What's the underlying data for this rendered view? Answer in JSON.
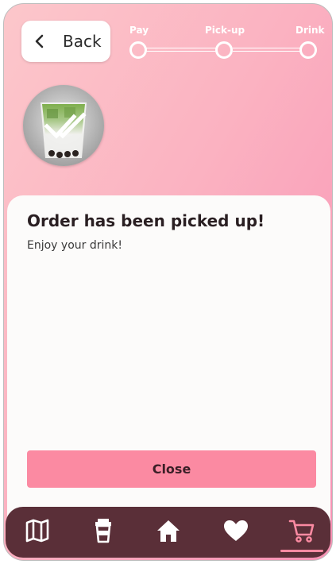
{
  "header": {
    "back_label": "Back"
  },
  "stepper": {
    "steps": [
      {
        "label": "Pay"
      },
      {
        "label": "Pick-up"
      },
      {
        "label": "Drink"
      }
    ]
  },
  "order": {
    "title": "Order has been picked up!",
    "subtitle": "Enjoy your drink!",
    "close_label": "Close"
  },
  "bottom_nav": {
    "items": [
      {
        "icon": "map-icon",
        "active": false
      },
      {
        "icon": "cup-icon",
        "active": false
      },
      {
        "icon": "home-icon",
        "active": false
      },
      {
        "icon": "heart-icon",
        "active": false
      },
      {
        "icon": "cart-icon",
        "active": true
      }
    ]
  },
  "colors": {
    "accent": "#fb8aa2",
    "nav_bg": "#5a2f38",
    "sheet_bg": "#fcfbfa"
  }
}
